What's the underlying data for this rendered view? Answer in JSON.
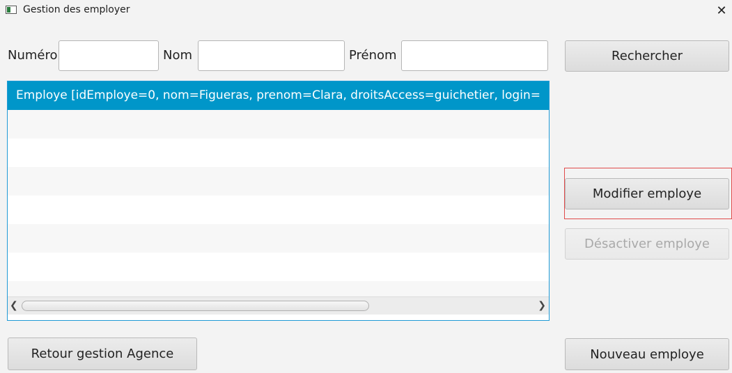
{
  "window": {
    "title": "Gestion des employer",
    "close_glyph": "✕"
  },
  "search": {
    "numero_label": "Numéro",
    "numero_value": "",
    "nom_label": "Nom",
    "nom_value": "",
    "prenom_label": "Prénom",
    "prenom_value": "",
    "search_button": "Rechercher"
  },
  "list": {
    "items": [
      "Employe [idEmploye=0, nom=Figueras, prenom=Clara, droitsAccess=guichetier, login=",
      "",
      "",
      "",
      "",
      "",
      ""
    ],
    "selected_index": 0,
    "scroll_left_glyph": "❮",
    "scroll_right_glyph": "❯"
  },
  "actions": {
    "modify_button": "Modifier employe",
    "deactivate_button": "Désactiver employe",
    "new_button": "Nouveau employe",
    "back_button": "Retour gestion Agence"
  },
  "colors": {
    "selection": "#0096c9",
    "focus_ring": "#e04a4a",
    "list_border": "#1f9ad6"
  }
}
